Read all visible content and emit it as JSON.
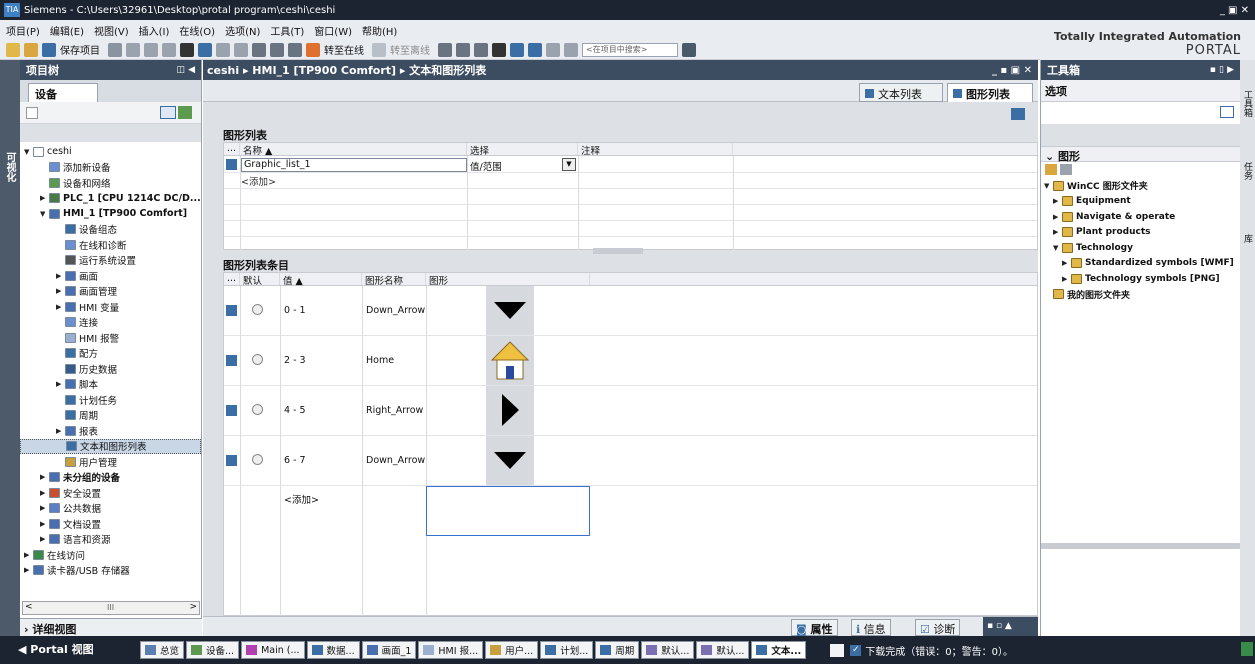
{
  "window": {
    "title": "Siemens  -  C:\\Users\\32961\\Desktop\\protal program\\ceshi\\ceshi",
    "controls": "_ ▣ ✕"
  },
  "menu": [
    "项目(P)",
    "编辑(E)",
    "视图(V)",
    "插入(I)",
    "在线(O)",
    "选项(N)",
    "工具(T)",
    "窗口(W)",
    "帮助(H)"
  ],
  "toolbar": {
    "save_label": "保存项目",
    "go_online": "转至在线",
    "go_offline": "转至离线",
    "search_placeholder": "<在项目中搜索>"
  },
  "brand": {
    "line1": "Totally Integrated Automation",
    "line2": "PORTAL"
  },
  "left_strip": {
    "label": "可视化"
  },
  "project_tree": {
    "title": "项目树",
    "tab": "设备",
    "nodes": [
      {
        "label": "ceshi",
        "level": 0,
        "arrow": "▼",
        "bold": false,
        "color": "#ffffff"
      },
      {
        "label": "添加新设备",
        "level": 1,
        "arrow": "",
        "bold": false,
        "color": "#6b8fd1"
      },
      {
        "label": "设备和网络",
        "level": 1,
        "arrow": "",
        "bold": false,
        "color": "#5b9a4f"
      },
      {
        "label": "PLC_1 [CPU 1214C DC/D...",
        "level": 1,
        "arrow": "▶",
        "bold": true,
        "color": "#4a7a4a"
      },
      {
        "label": "HMI_1 [TP900 Comfort]",
        "level": 1,
        "arrow": "▼",
        "bold": true,
        "color": "#4a6fb0"
      },
      {
        "label": "设备组态",
        "level": 2,
        "arrow": "",
        "bold": false,
        "color": "#3a6ea5"
      },
      {
        "label": "在线和诊断",
        "level": 2,
        "arrow": "",
        "bold": false,
        "color": "#6b8fd1"
      },
      {
        "label": "运行系统设置",
        "level": 2,
        "arrow": "",
        "bold": false,
        "color": "#555555"
      },
      {
        "label": "画面",
        "level": 2,
        "arrow": "▶",
        "bold": false,
        "color": "#4a6fb0"
      },
      {
        "label": "画面管理",
        "level": 2,
        "arrow": "▶",
        "bold": false,
        "color": "#4a6fb0"
      },
      {
        "label": "HMI 变量",
        "level": 2,
        "arrow": "▶",
        "bold": false,
        "color": "#4a6fb0"
      },
      {
        "label": "连接",
        "level": 2,
        "arrow": "",
        "bold": false,
        "color": "#6b8fd1"
      },
      {
        "label": "HMI 报警",
        "level": 2,
        "arrow": "",
        "bold": false,
        "color": "#9bb0cf"
      },
      {
        "label": "配方",
        "level": 2,
        "arrow": "",
        "bold": false,
        "color": "#3a6ea5"
      },
      {
        "label": "历史数据",
        "level": 2,
        "arrow": "",
        "bold": false,
        "color": "#3a5a8a"
      },
      {
        "label": "脚本",
        "level": 2,
        "arrow": "▶",
        "bold": false,
        "color": "#4a6fb0"
      },
      {
        "label": "计划任务",
        "level": 2,
        "arrow": "",
        "bold": false,
        "color": "#3a6ea5"
      },
      {
        "label": "周期",
        "level": 2,
        "arrow": "",
        "bold": false,
        "color": "#3a6ea5"
      },
      {
        "label": "报表",
        "level": 2,
        "arrow": "▶",
        "bold": false,
        "color": "#4a6fb0"
      },
      {
        "label": "文本和图形列表",
        "level": 2,
        "arrow": "",
        "bold": false,
        "color": "#3a6ea5",
        "selected": true
      },
      {
        "label": "用户管理",
        "level": 2,
        "arrow": "",
        "bold": false,
        "color": "#c8a040"
      },
      {
        "label": "未分组的设备",
        "level": 1,
        "arrow": "▶",
        "bold": true,
        "color": "#4a6fb0"
      },
      {
        "label": "安全设置",
        "level": 1,
        "arrow": "▶",
        "bold": false,
        "color": "#c85030"
      },
      {
        "label": "公共数据",
        "level": 1,
        "arrow": "▶",
        "bold": false,
        "color": "#5b7fc4"
      },
      {
        "label": "文档设置",
        "level": 1,
        "arrow": "▶",
        "bold": false,
        "color": "#4a6fb0"
      },
      {
        "label": "语言和资源",
        "level": 1,
        "arrow": "▶",
        "bold": false,
        "color": "#4a6fb0"
      },
      {
        "label": "在线访问",
        "level": 0,
        "arrow": "▶",
        "bold": false,
        "color": "#3a8a4a"
      },
      {
        "label": "读卡器/USB 存储器",
        "level": 0,
        "arrow": "▶",
        "bold": false,
        "color": "#4a6fb0"
      }
    ],
    "scroll_label": "III",
    "details": "详细视图"
  },
  "editor": {
    "breadcrumb": "ceshi  ▸  HMI_1 [TP900 Comfort]  ▸  文本和图形列表",
    "tabs": [
      "文本列表",
      "图形列表"
    ],
    "graphic_list": {
      "title": "图形列表",
      "columns": [
        "名称 ▲",
        "选择",
        "注释"
      ],
      "rows": [
        {
          "name": "Graphic_list_1",
          "select": "值/范围",
          "comment": ""
        }
      ],
      "add": "<添加>"
    },
    "entries": {
      "title": "图形列表条目",
      "columns": [
        "默认",
        "值 ▲",
        "图形名称",
        "图形"
      ],
      "rows": [
        {
          "value": "0 - 1",
          "name": "Down_Arrow",
          "glyph": "down"
        },
        {
          "value": "2 - 3",
          "name": "Home",
          "glyph": "home"
        },
        {
          "value": "4 - 5",
          "name": "Right_Arrow",
          "glyph": "right"
        },
        {
          "value": "6 - 7",
          "name": "Down_Arrow",
          "glyph": "down"
        }
      ],
      "add": "<添加>"
    }
  },
  "status_tabs": [
    "属性",
    "信息",
    "诊断"
  ],
  "toolbox": {
    "title": "工具箱",
    "options": "选项",
    "section": "图形",
    "nodes": [
      {
        "label": "WinCC 图形文件夹",
        "level": 0,
        "arrow": "▼",
        "bold": true
      },
      {
        "label": "Equipment",
        "level": 1,
        "arrow": "▶",
        "bold": true
      },
      {
        "label": "Navigate & operate",
        "level": 1,
        "arrow": "▶",
        "bold": true
      },
      {
        "label": "Plant products",
        "level": 1,
        "arrow": "▶",
        "bold": true
      },
      {
        "label": "Technology",
        "level": 1,
        "arrow": "▼",
        "bold": true
      },
      {
        "label": "Standardized symbols [WMF]",
        "level": 2,
        "arrow": "▶",
        "bold": true
      },
      {
        "label": "Technology symbols [PNG]",
        "level": 2,
        "arrow": "▶",
        "bold": true
      },
      {
        "label": "我的图形文件夹",
        "level": 0,
        "arrow": "",
        "bold": true
      }
    ]
  },
  "right_strip": [
    "工具箱",
    "任务",
    "库"
  ],
  "taskbar": {
    "portal": "Portal 视图",
    "items": [
      {
        "label": "总览",
        "color": "#5a7fb0"
      },
      {
        "label": "设备...",
        "color": "#5b9a4f"
      },
      {
        "label": "Main (...",
        "color": "#b040b0"
      },
      {
        "label": "数据...",
        "color": "#3a6ea5"
      },
      {
        "label": "画面_1",
        "color": "#4a6fb0"
      },
      {
        "label": "HMI 报...",
        "color": "#9bb0cf"
      },
      {
        "label": "用户...",
        "color": "#c8a040"
      },
      {
        "label": "计划...",
        "color": "#3a6ea5"
      },
      {
        "label": "周期",
        "color": "#3a6ea5"
      },
      {
        "label": "默认...",
        "color": "#7a6fb0"
      },
      {
        "label": "默认...",
        "color": "#7a6fb0"
      },
      {
        "label": "文本...",
        "color": "#3a6ea5"
      }
    ],
    "status": "下载完成（错误：0；警告：0）。"
  }
}
